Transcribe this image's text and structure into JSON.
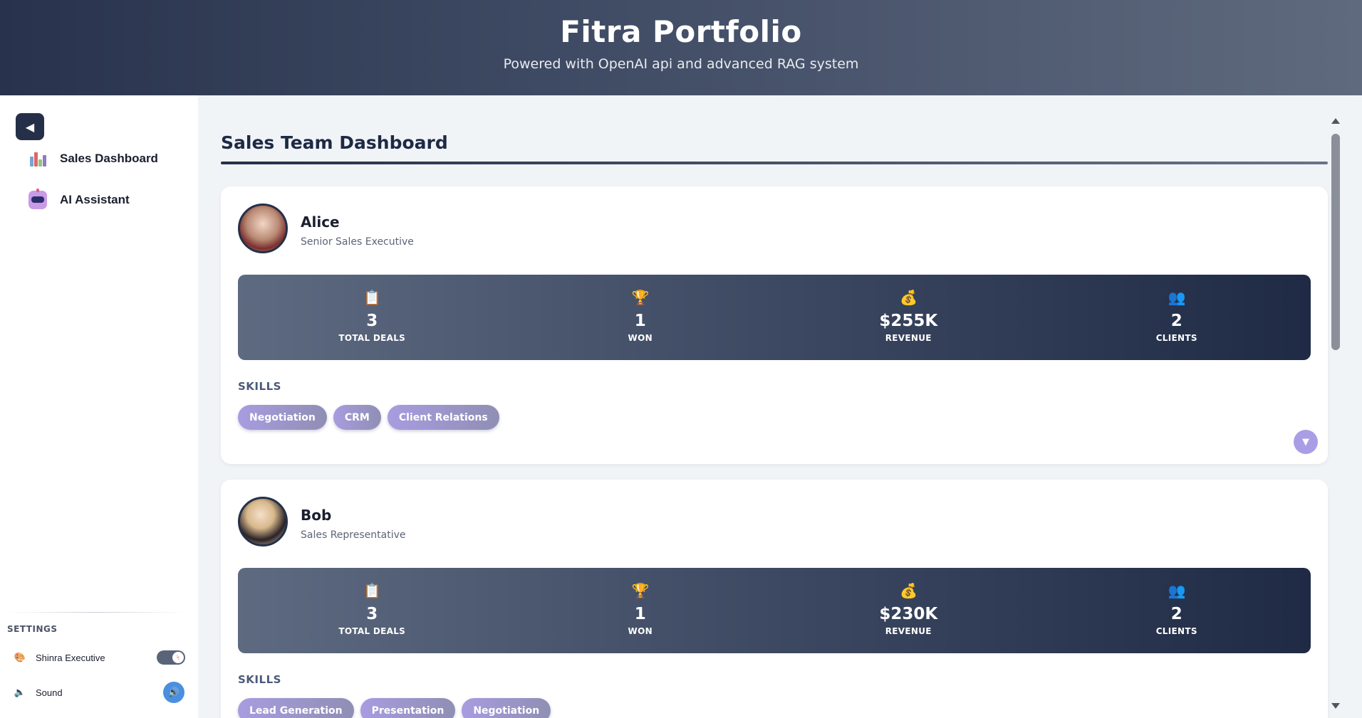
{
  "header": {
    "title": "Fitra Portfolio",
    "subtitle": "Powered with OpenAI api and advanced RAG system"
  },
  "sidebar": {
    "collapse_icon": "triangle-left-icon",
    "items": [
      {
        "label": "Sales Dashboard",
        "icon": "bar-chart-icon"
      },
      {
        "label": "AI Assistant",
        "icon": "robot-icon"
      }
    ],
    "settings": {
      "label": "SETTINGS",
      "theme": {
        "label": "Shinra Executive",
        "icon": "palette-icon",
        "enabled": true
      },
      "sound": {
        "label": "Sound",
        "icon": "speaker-icon"
      }
    }
  },
  "main": {
    "title": "Sales Team Dashboard",
    "members": [
      {
        "name": "Alice",
        "role": "Senior Sales Executive",
        "stats": [
          {
            "icon": "clipboard-icon",
            "value": "3",
            "label": "TOTAL DEALS"
          },
          {
            "icon": "trophy-icon",
            "value": "1",
            "label": "WON"
          },
          {
            "icon": "money-bag-icon",
            "value": "$255K",
            "label": "REVENUE"
          },
          {
            "icon": "people-icon",
            "value": "2",
            "label": "CLIENTS"
          }
        ],
        "skills_label": "SKILLS",
        "skills": [
          "Negotiation",
          "CRM",
          "Client Relations"
        ]
      },
      {
        "name": "Bob",
        "role": "Sales Representative",
        "stats": [
          {
            "icon": "clipboard-icon",
            "value": "3",
            "label": "TOTAL DEALS"
          },
          {
            "icon": "trophy-icon",
            "value": "1",
            "label": "WON"
          },
          {
            "icon": "money-bag-icon",
            "value": "$230K",
            "label": "REVENUE"
          },
          {
            "icon": "people-icon",
            "value": "2",
            "label": "CLIENTS"
          }
        ],
        "skills_label": "SKILLS",
        "skills": [
          "Lead Generation",
          "Presentation",
          "Negotiation"
        ]
      }
    ]
  },
  "colors": {
    "header_start": "#28324c",
    "header_end": "#5f6a7e",
    "accent": "#253048",
    "chip": "#a89ce0",
    "sound_button": "#4a8fe0"
  }
}
